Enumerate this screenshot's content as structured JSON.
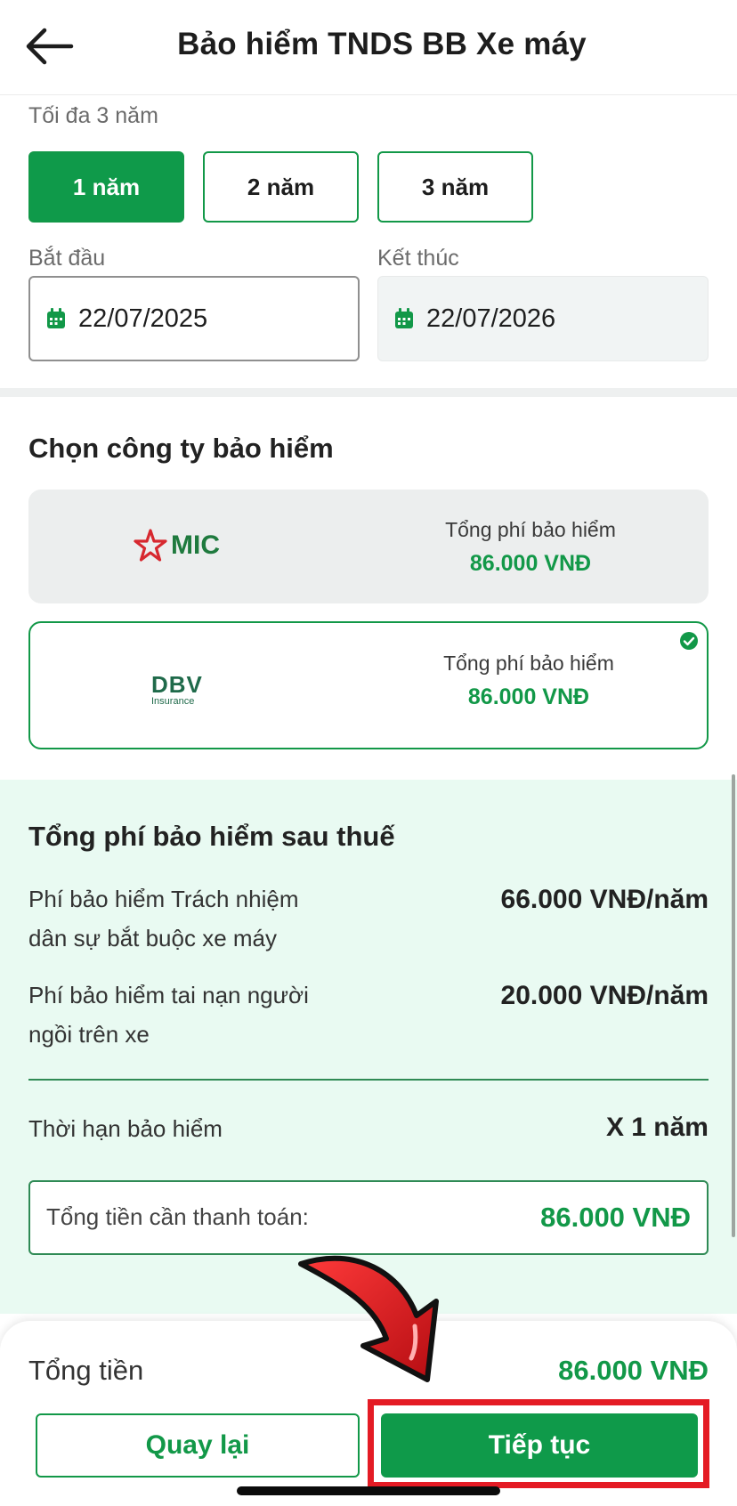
{
  "header": {
    "title": "Bảo hiểm TNDS BB Xe máy"
  },
  "duration": {
    "label": "Tối đa 3 năm",
    "options": [
      "1 năm",
      "2 năm",
      "3 năm"
    ],
    "selected": "1 năm"
  },
  "dates": {
    "start_label": "Bắt đầu",
    "start_value": "22/07/2025",
    "end_label": "Kết thúc",
    "end_value": "22/07/2026"
  },
  "insurers": {
    "title": "Chọn công ty bảo hiểm",
    "items": [
      {
        "logo": "MIC",
        "fee_label": "Tổng phí bảo hiểm",
        "fee_value": "86.000 VNĐ",
        "selected": false
      },
      {
        "logo": "DBV",
        "logo_sub": "Insurance",
        "fee_label": "Tổng phí bảo hiểm",
        "fee_value": "86.000 VNĐ",
        "selected": true
      }
    ]
  },
  "summary": {
    "title": "Tổng phí bảo hiểm sau thuế",
    "rows": [
      {
        "label_line1": "Phí bảo hiểm Trách nhiệm",
        "label_line2": "dân sự bắt buộc xe máy",
        "value": "66.000 VNĐ/năm"
      },
      {
        "label_line1": "Phí bảo hiểm tai nạn người",
        "label_line2": "ngồi trên xe",
        "value": "20.000 VNĐ/năm"
      }
    ],
    "term_label": "Thời hạn bảo hiểm",
    "term_value": "X 1 năm",
    "total_label": "Tổng tiền cần thanh toán:",
    "total_value": "86.000 VNĐ"
  },
  "footer": {
    "total_label": "Tổng tiền",
    "total_value": "86.000 VNĐ",
    "back_label": "Quay lại",
    "next_label": "Tiếp tục"
  },
  "colors": {
    "primary": "#0f9a4a",
    "summary_bg": "#e9faf2",
    "highlight": "#e41b24",
    "mic_red": "#d7282f"
  }
}
